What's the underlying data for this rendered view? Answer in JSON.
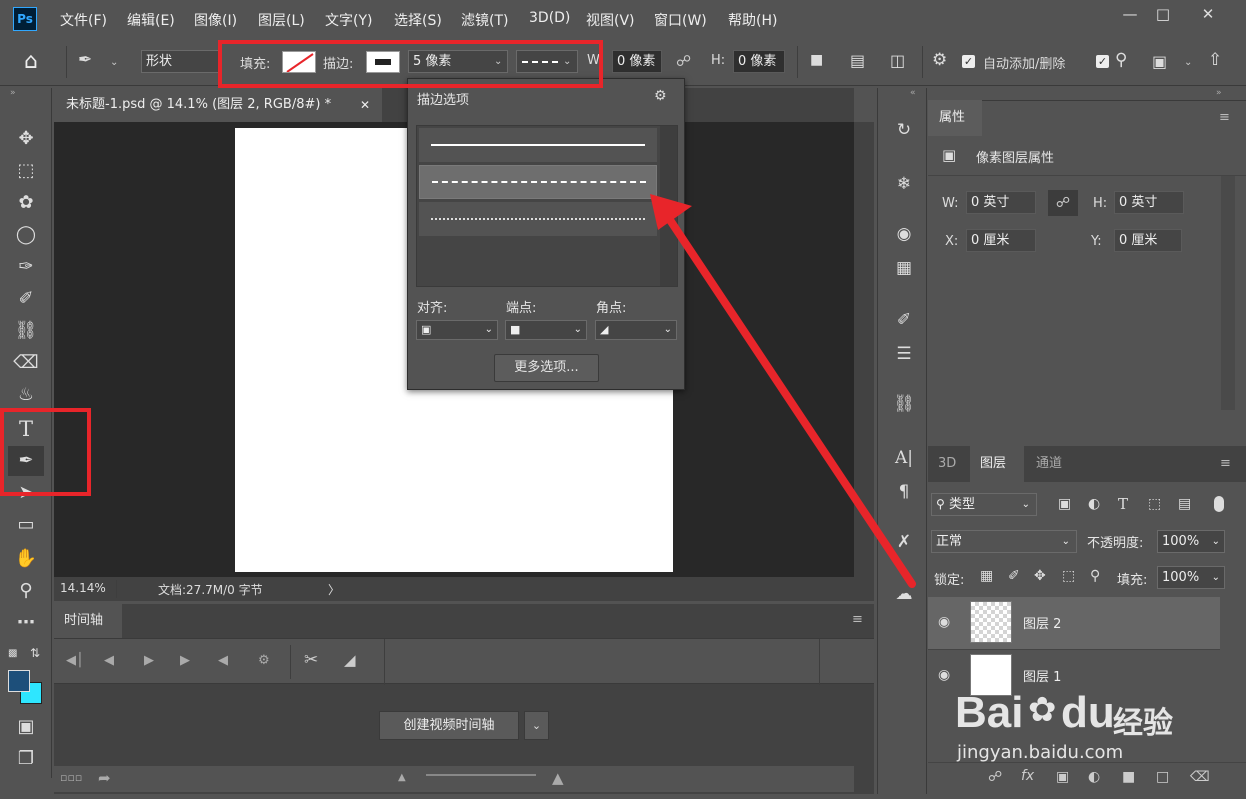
{
  "app": {
    "logo": "Ps"
  },
  "menu": [
    "文件(F)",
    "编辑(E)",
    "图像(I)",
    "图层(L)",
    "文字(Y)",
    "选择(S)",
    "滤镜(T)",
    "3D(D)",
    "视图(V)",
    "窗口(W)",
    "帮助(H)"
  ],
  "window_controls": [
    "minimize",
    "restore",
    "close"
  ],
  "options": {
    "mode": "形状",
    "fill_label": "填充:",
    "stroke_label": "描边:",
    "stroke_width": "5 像素",
    "w_label": "W:",
    "w_value": "0 像素",
    "h_label": "H:",
    "h_value": "0 像素",
    "auto_add_delete": "自动添加/删除"
  },
  "document": {
    "tab_title": "未标题-1.psd @ 14.1% (图层 2, RGB/8#) *"
  },
  "status": {
    "zoom": "14.14%",
    "doc_info": "文档:27.7M/0 字节"
  },
  "timeline": {
    "tab": "时间轴",
    "create_button": "创建视频时间轴"
  },
  "properties": {
    "tab": "属性",
    "header": "像素图层属性",
    "w_label": "W:",
    "w_value": "0 英寸",
    "h_label": "H:",
    "h_value": "0 英寸",
    "x_label": "X:",
    "x_value": "0 厘米",
    "y_label": "Y:",
    "y_value": "0 厘米"
  },
  "layers": {
    "tabs": [
      "3D",
      "图层",
      "通道"
    ],
    "active_tab": "图层",
    "filter": "类型",
    "blend_mode": "正常",
    "opacity_label": "不透明度:",
    "opacity_value": "100%",
    "lock_label": "锁定:",
    "fill_label": "填充:",
    "fill_value": "100%",
    "items": [
      {
        "name": "图层 2",
        "visible": true,
        "selected": true
      },
      {
        "name": "图层 1",
        "visible": true,
        "selected": false
      }
    ]
  },
  "stroke_popup": {
    "title": "描边选项",
    "styles": [
      "solid",
      "dashed",
      "dotted"
    ],
    "selected_style": "dashed",
    "align_label": "对齐:",
    "caps_label": "端点:",
    "corners_label": "角点:",
    "more_button": "更多选项..."
  },
  "watermark": {
    "brand": "Bai",
    "brand_tail": "du",
    "suffix": "经验",
    "url": "jingyan.baidu.com"
  },
  "colors": {
    "highlight": "#e8252a",
    "foreground": "#1d4f7a",
    "background": "#2ee6ff"
  }
}
